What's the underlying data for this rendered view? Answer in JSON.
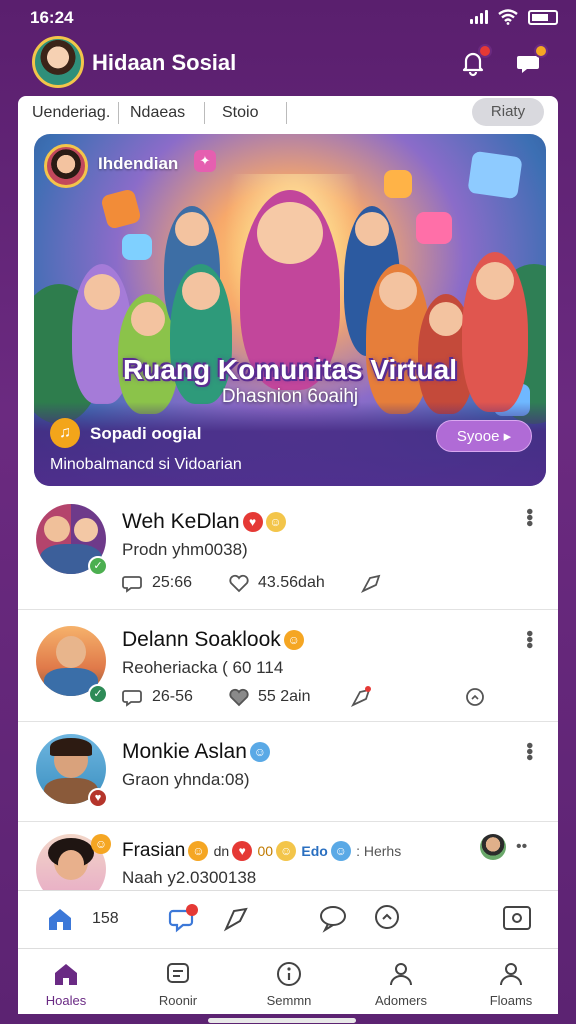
{
  "status_bar": {
    "time": "16:24"
  },
  "header": {
    "app_title": "Hidaan Sosial"
  },
  "tabs": {
    "items": [
      "Uenderiag.",
      "Ndaeas",
      "Stoio"
    ],
    "pill": "Riaty"
  },
  "banner": {
    "user_name": "Ihdendian",
    "title": "Ruang Komunitas Virtual",
    "subtitle": "Dhasnion 6oaihj",
    "group_name": "Sopadi oogial",
    "description": "Minobalmancd si Vidoarian",
    "see_button": "Syooe"
  },
  "posts": [
    {
      "name": "Weh KeDlan",
      "meta": "Prodn yhm0038)",
      "comments": "25:66",
      "likes": "43.56dah"
    },
    {
      "name": "Delann Soaklook",
      "meta": "Reoheriacka ( 60 114",
      "comments": "26-56",
      "likes": "55 2ain"
    },
    {
      "name": "Monkie Aslan",
      "meta": "Graon yhnda:08)"
    },
    {
      "name": "Frasian",
      "meta": "Naah y2.0300138",
      "tail_text": ": Herhs",
      "emoji_labels": [
        "dn",
        "00",
        "Edo"
      ]
    }
  ],
  "toolbar": {
    "count": "158"
  },
  "bottom_nav": {
    "items": [
      {
        "label": "Hoales",
        "icon": "home-icon"
      },
      {
        "label": "Roonir",
        "icon": "chat-list-icon"
      },
      {
        "label": "Semmn",
        "icon": "info-circle-icon"
      },
      {
        "label": "Adomers",
        "icon": "person-icon"
      },
      {
        "label": "Floams",
        "icon": "profile-icon"
      }
    ]
  },
  "colors": {
    "brand": "#6a2a84",
    "accent": "#b06bd6",
    "badge_red": "#e53935"
  }
}
